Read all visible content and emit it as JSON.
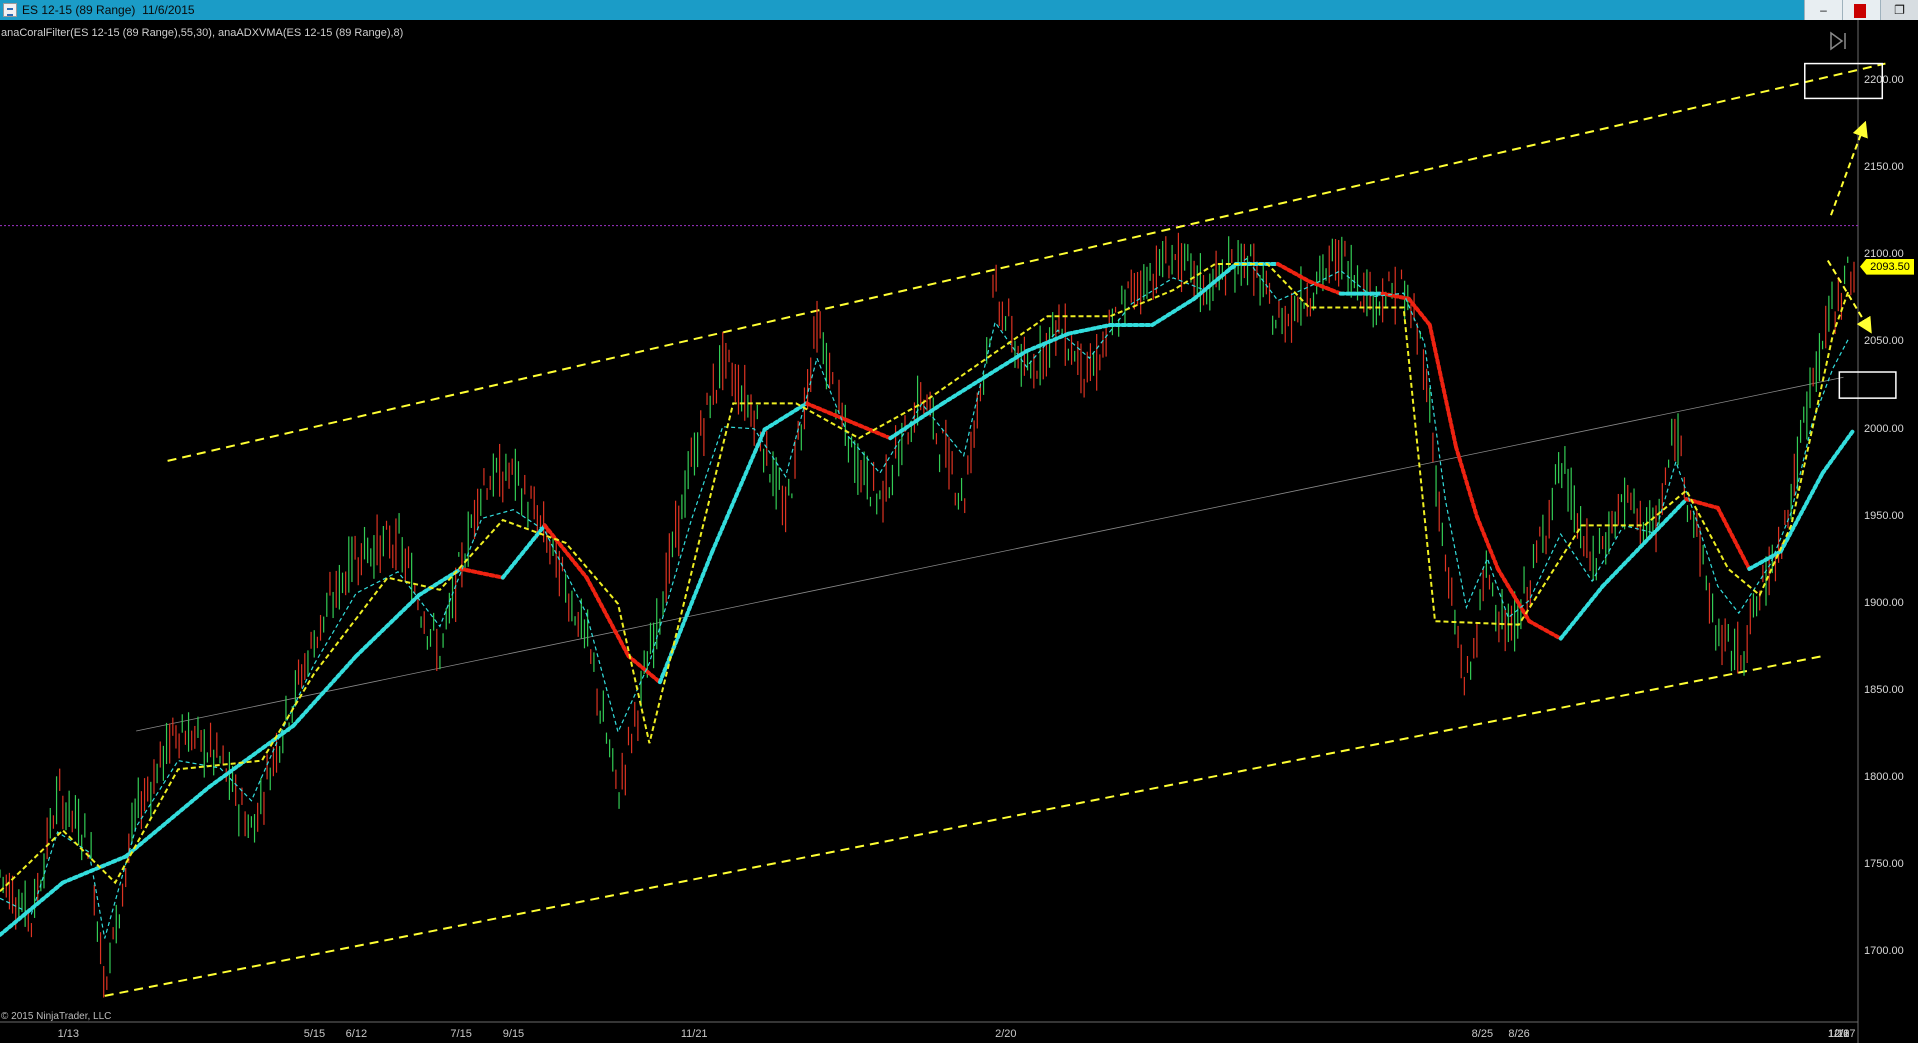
{
  "window": {
    "title": "ES 12-15 (89 Range)  11/6/2015",
    "buttons": {
      "minimize": "–",
      "restore": "❐"
    }
  },
  "indicator_label": "anaCoralFilter(ES 12-15 (89 Range),55,30), anaADXVMA(ES 12-15 (89 Range),8)",
  "copyright": "© 2015 NinjaTrader, LLC",
  "current_price": "2093.50",
  "colors": {
    "titlebar": "#1b9cc7",
    "up_bar": "#33cc55",
    "down_bar": "#dd3322",
    "channel": "#ffff33",
    "coral_up": "#33dddd",
    "coral_down": "#ee2211",
    "adxvma": "#eeee22",
    "resistance": "#a033c8"
  },
  "chart_data": {
    "type": "candlestick",
    "ylim": [
      1660,
      2235
    ],
    "y_ticks": [
      "2200.00",
      "2150.00",
      "2100.00",
      "2050.00",
      "2000.00",
      "1950.00",
      "1900.00",
      "1850.00",
      "1800.00",
      "1750.00",
      "1700.00"
    ],
    "y_tick_values": [
      2200,
      2150,
      2100,
      2050,
      2000,
      1950,
      1900,
      1850,
      1800,
      1750,
      1700
    ],
    "x_labels": [
      "1/13",
      "5/15",
      "6/12",
      "7/15",
      "9/15",
      "11/21",
      "2/20",
      "8/25",
      "8/26",
      "12/8",
      "12/27",
      "1/10",
      "1/21"
    ],
    "x_label_index": [
      55,
      290,
      330,
      430,
      480,
      650,
      950,
      1405,
      1440,
      1770,
      1800,
      1825,
      1845
    ],
    "resistance_level": 2117,
    "price_path": [
      [
        0,
        1745
      ],
      [
        30,
        1720
      ],
      [
        55,
        1790
      ],
      [
        85,
        1765
      ],
      [
        100,
        1680
      ],
      [
        130,
        1780
      ],
      [
        170,
        1830
      ],
      [
        210,
        1810
      ],
      [
        240,
        1770
      ],
      [
        270,
        1830
      ],
      [
        300,
        1880
      ],
      [
        340,
        1930
      ],
      [
        380,
        1935
      ],
      [
        420,
        1870
      ],
      [
        460,
        1970
      ],
      [
        490,
        1975
      ],
      [
        520,
        1940
      ],
      [
        560,
        1880
      ],
      [
        590,
        1790
      ],
      [
        620,
        1870
      ],
      [
        660,
        1980
      ],
      [
        690,
        2040
      ],
      [
        720,
        2010
      ],
      [
        750,
        1950
      ],
      [
        780,
        2060
      ],
      [
        810,
        1990
      ],
      [
        840,
        1960
      ],
      [
        880,
        2020
      ],
      [
        920,
        1960
      ],
      [
        950,
        2080
      ],
      [
        980,
        2030
      ],
      [
        1010,
        2060
      ],
      [
        1040,
        2030
      ],
      [
        1080,
        2080
      ],
      [
        1120,
        2100
      ],
      [
        1150,
        2080
      ],
      [
        1190,
        2100
      ],
      [
        1220,
        2060
      ],
      [
        1250,
        2080
      ],
      [
        1280,
        2100
      ],
      [
        1310,
        2075
      ],
      [
        1340,
        2080
      ],
      [
        1360,
        2040
      ],
      [
        1380,
        1920
      ],
      [
        1400,
        1850
      ],
      [
        1420,
        1920
      ],
      [
        1440,
        1880
      ],
      [
        1460,
        1910
      ],
      [
        1490,
        1980
      ],
      [
        1520,
        1920
      ],
      [
        1550,
        1960
      ],
      [
        1580,
        1940
      ],
      [
        1600,
        2000
      ],
      [
        1620,
        1940
      ],
      [
        1640,
        1880
      ],
      [
        1660,
        1870
      ],
      [
        1690,
        1920
      ],
      [
        1710,
        1960
      ],
      [
        1730,
        2030
      ],
      [
        1750,
        2070
      ],
      [
        1765,
        2090
      ]
    ],
    "coral_filter": [
      [
        0,
        1710
      ],
      [
        60,
        1740
      ],
      [
        120,
        1755
      ],
      [
        200,
        1795
      ],
      [
        280,
        1830
      ],
      [
        340,
        1870
      ],
      [
        400,
        1905
      ],
      [
        440,
        1920
      ],
      [
        480,
        1915
      ],
      [
        520,
        1945
      ],
      [
        560,
        1915
      ],
      [
        600,
        1870
      ],
      [
        630,
        1855
      ],
      [
        680,
        1930
      ],
      [
        730,
        2000
      ],
      [
        770,
        2015
      ],
      [
        810,
        2005
      ],
      [
        850,
        1995
      ],
      [
        900,
        2015
      ],
      [
        940,
        2030
      ],
      [
        980,
        2045
      ],
      [
        1020,
        2055
      ],
      [
        1060,
        2060
      ],
      [
        1100,
        2060
      ],
      [
        1140,
        2075
      ],
      [
        1180,
        2095
      ],
      [
        1220,
        2095
      ],
      [
        1250,
        2085
      ],
      [
        1280,
        2078
      ],
      [
        1320,
        2078
      ],
      [
        1345,
        2075
      ],
      [
        1365,
        2060
      ],
      [
        1390,
        1990
      ],
      [
        1410,
        1950
      ],
      [
        1430,
        1920
      ],
      [
        1460,
        1890
      ],
      [
        1490,
        1880
      ],
      [
        1530,
        1910
      ],
      [
        1570,
        1935
      ],
      [
        1610,
        1960
      ],
      [
        1640,
        1955
      ],
      [
        1670,
        1920
      ],
      [
        1700,
        1930
      ],
      [
        1740,
        1975
      ],
      [
        1770,
        2000
      ]
    ],
    "adxvma": [
      [
        0,
        1735
      ],
      [
        60,
        1770
      ],
      [
        110,
        1740
      ],
      [
        170,
        1805
      ],
      [
        250,
        1810
      ],
      [
        300,
        1860
      ],
      [
        370,
        1915
      ],
      [
        420,
        1908
      ],
      [
        480,
        1948
      ],
      [
        540,
        1935
      ],
      [
        590,
        1900
      ],
      [
        620,
        1820
      ],
      [
        700,
        2015
      ],
      [
        760,
        2015
      ],
      [
        820,
        1995
      ],
      [
        880,
        2015
      ],
      [
        940,
        2040
      ],
      [
        1000,
        2065
      ],
      [
        1060,
        2065
      ],
      [
        1120,
        2080
      ],
      [
        1160,
        2095
      ],
      [
        1210,
        2095
      ],
      [
        1250,
        2070
      ],
      [
        1290,
        2070
      ],
      [
        1340,
        2070
      ],
      [
        1370,
        1890
      ],
      [
        1450,
        1888
      ],
      [
        1510,
        1945
      ],
      [
        1570,
        1945
      ],
      [
        1610,
        1965
      ],
      [
        1650,
        1920
      ],
      [
        1680,
        1905
      ],
      [
        1710,
        1945
      ],
      [
        1750,
        2055
      ],
      [
        1765,
        2080
      ]
    ],
    "channel": {
      "upper": {
        "x": [
          160,
          1800
        ],
        "y": [
          1982,
          2210
        ]
      },
      "lower": {
        "x": [
          100,
          1740
        ],
        "y": [
          1675,
          1870
        ]
      },
      "middle": {
        "x": [
          130,
          1760
        ],
        "y": [
          1827,
          2030
        ]
      }
    },
    "annotation_boxes": [
      {
        "x_index": [
          1723,
          1797
        ],
        "y_range": [
          2190,
          2210
        ]
      },
      {
        "x_index": [
          1756,
          1810
        ],
        "y_range": [
          2018,
          2033
        ]
      }
    ],
    "arrows": [
      {
        "from": [
          1748,
          2123
        ],
        "to": [
          1780,
          2175
        ]
      },
      {
        "from": [
          1745,
          2097
        ],
        "to": [
          1785,
          2057
        ]
      }
    ]
  }
}
